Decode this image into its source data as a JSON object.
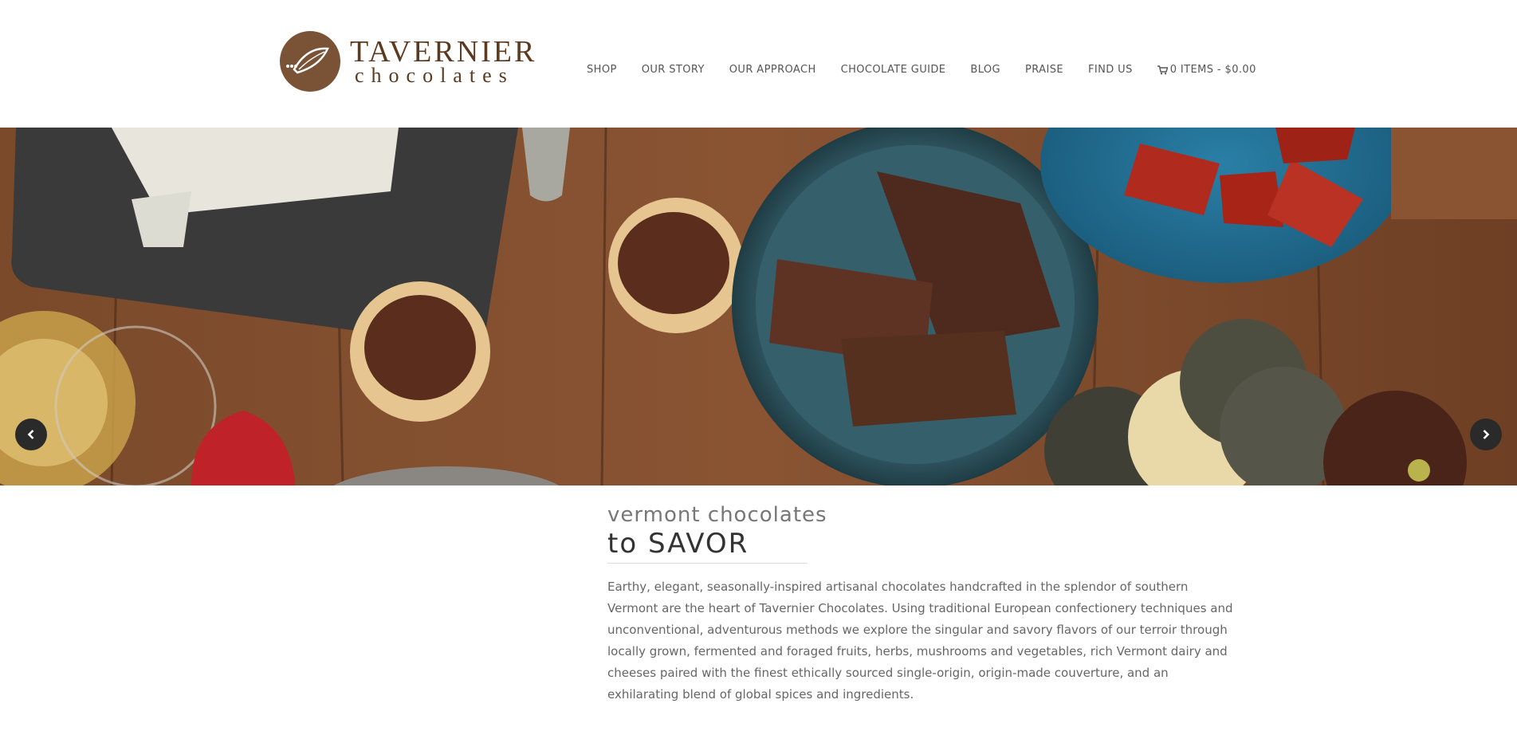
{
  "brand": {
    "name": "TAVERNIER",
    "sub": "chocolates",
    "color": "#5b3a1f",
    "mark_color": "#7a5236"
  },
  "nav": {
    "items": [
      {
        "label": "SHOP"
      },
      {
        "label": "OUR STORY"
      },
      {
        "label": "OUR APPROACH"
      },
      {
        "label": "CHOCOLATE GUIDE"
      },
      {
        "label": "BLOG"
      },
      {
        "label": "PRAISE"
      },
      {
        "label": "FIND US"
      }
    ],
    "cart_label": "0 ITEMS - $0.00",
    "cart_icon": "shopping-cart-icon"
  },
  "hero": {
    "prev_icon": "chevron-left-icon",
    "next_icon": "chevron-right-icon"
  },
  "content": {
    "subtitle": "vermont chocolates",
    "title": "to SAVOR",
    "body": "Earthy, elegant, seasonally-inspired artisanal chocolates handcrafted in the splendor of southern Vermont are the heart of Tavernier Chocolates. Using traditional European confectionery techniques and unconventional, adventurous methods we explore the singular and savory flavors of our terroir through locally grown, fermented and foraged fruits, herbs, mushrooms and vegetables, rich Vermont dairy and cheeses paired with the finest ethically sourced single-origin, origin-made couverture, and an exhilarating blend of global spices and ingredients."
  }
}
